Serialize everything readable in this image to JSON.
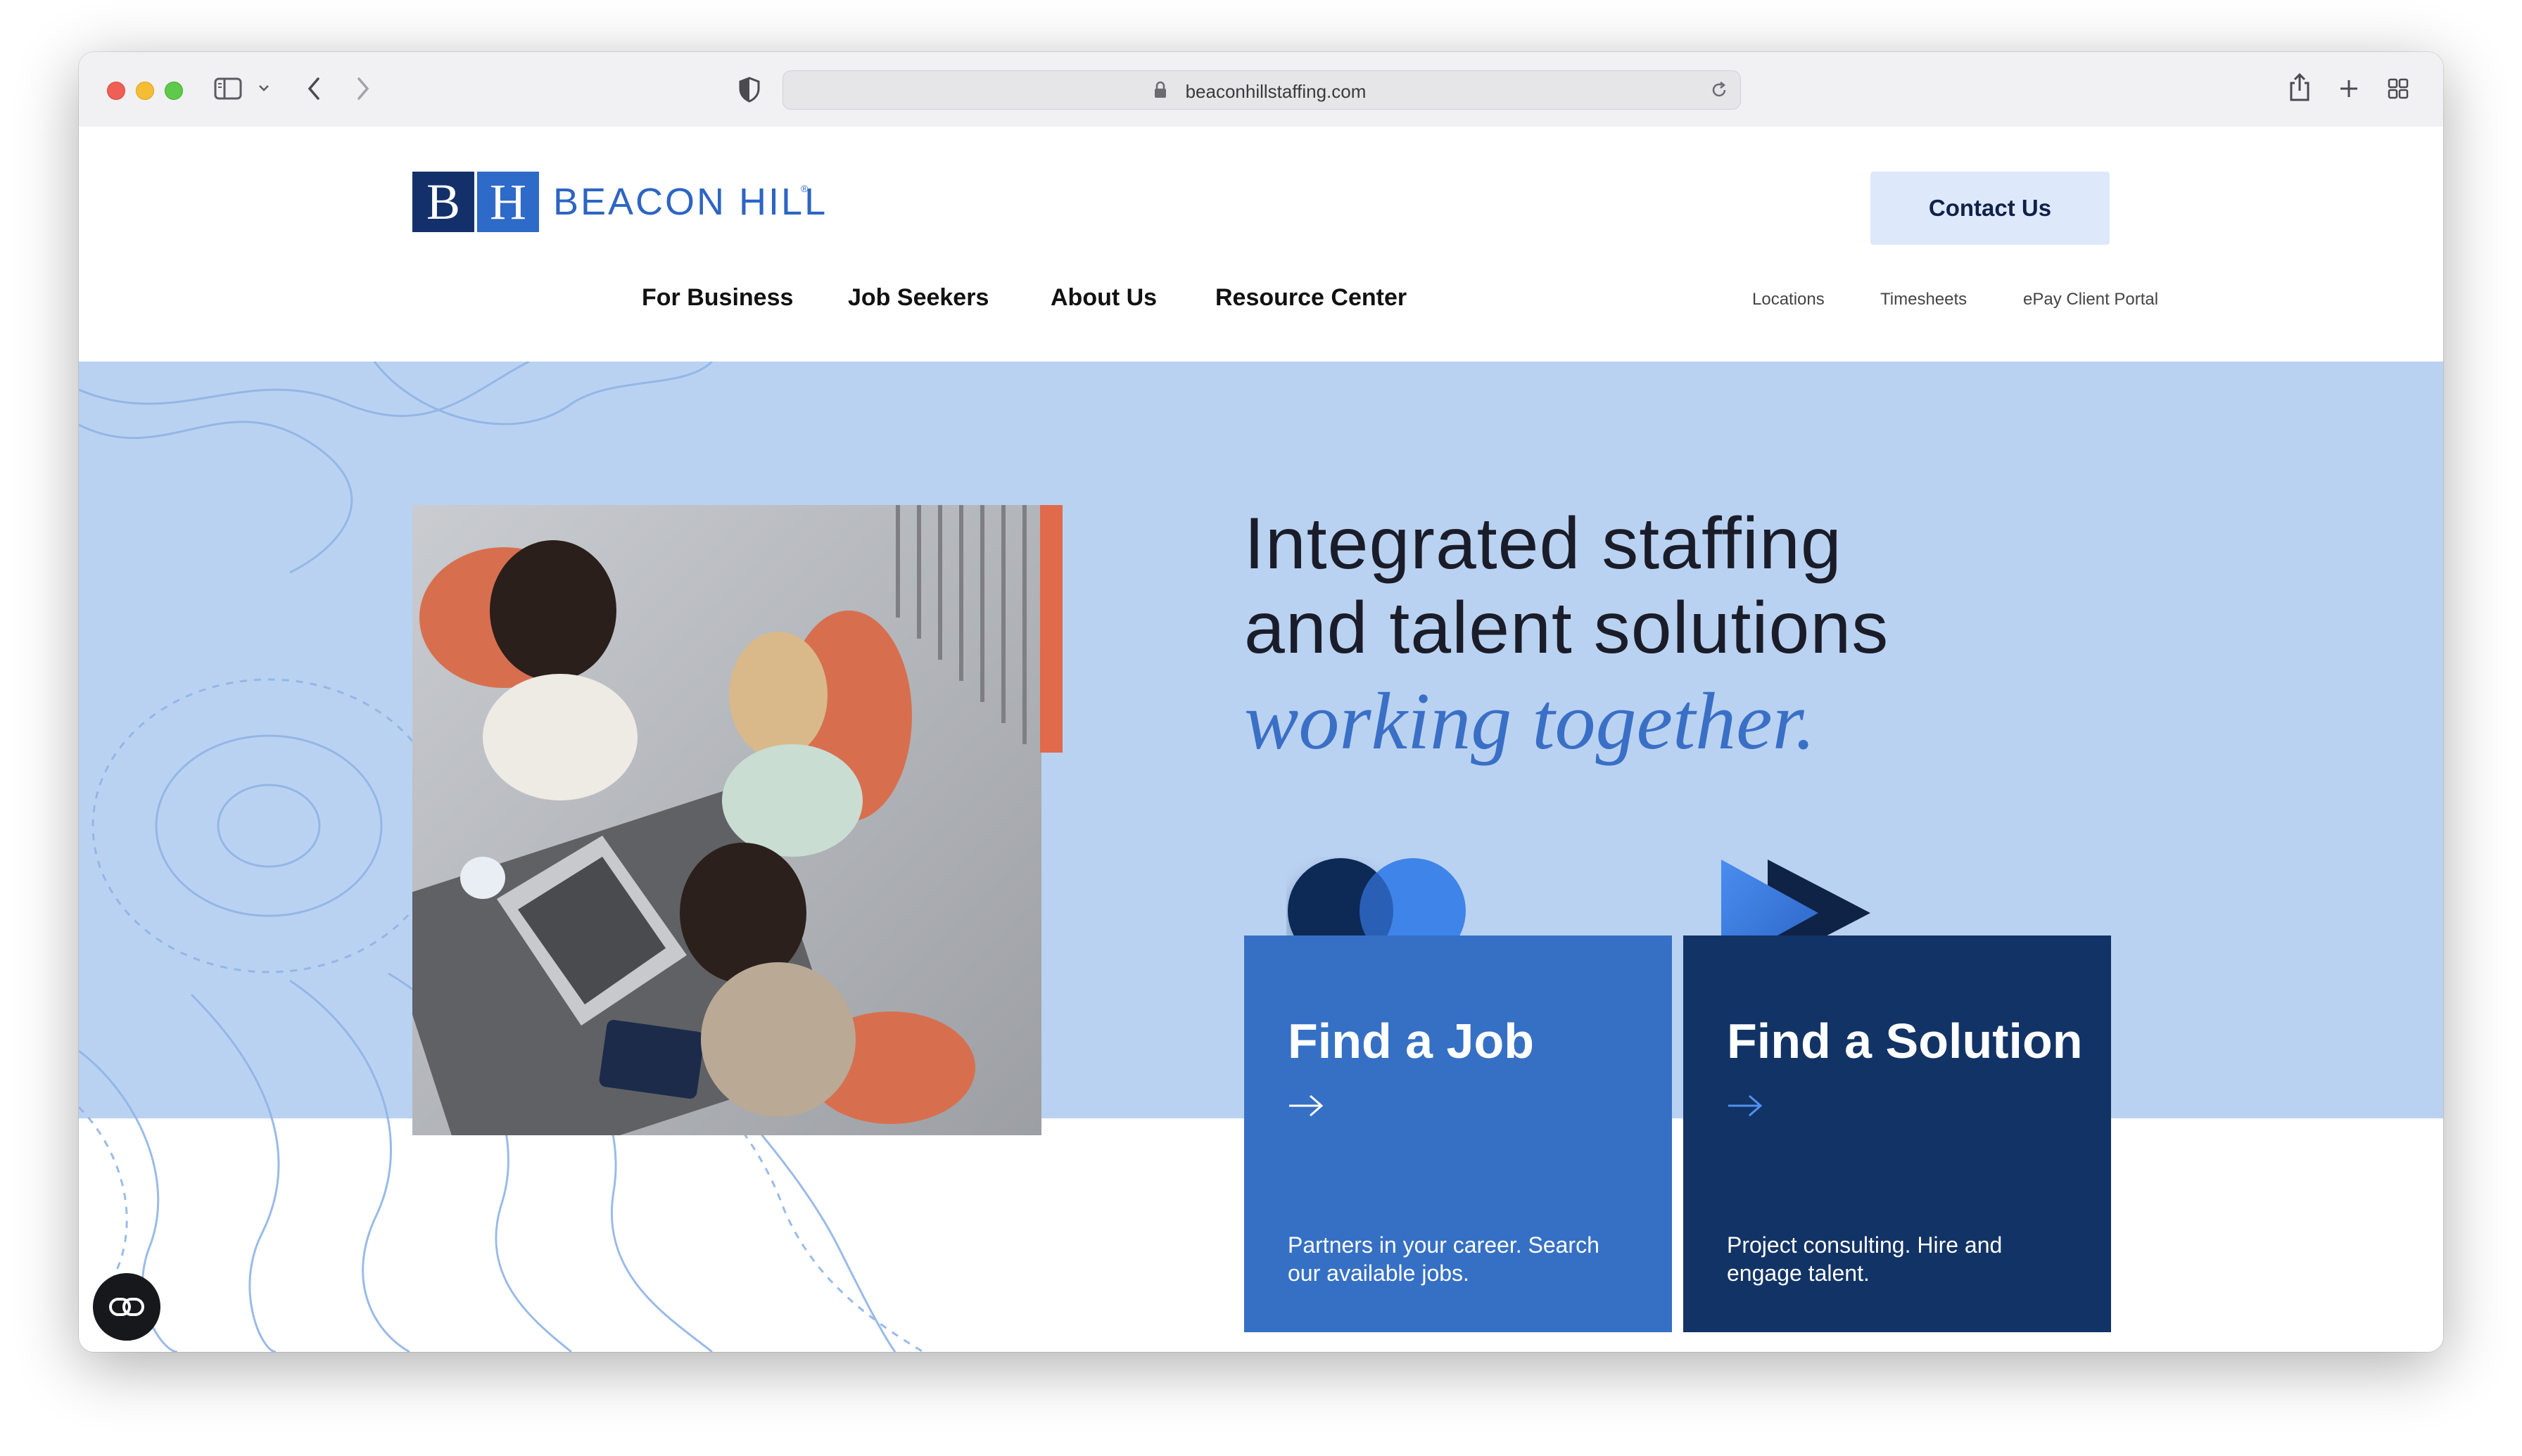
{
  "browser": {
    "url": "beaconhillstaffing.com"
  },
  "site": {
    "logo": {
      "mark_b": "B",
      "mark_h": "H",
      "name": "BEACON HILL",
      "reg": "®"
    },
    "contact_label": "Contact Us",
    "nav": [
      "For Business",
      "Job Seekers",
      "About Us",
      "Resource Center"
    ],
    "utility_links": [
      "Locations",
      "Timesheets",
      "ePay Client Portal"
    ]
  },
  "hero": {
    "line1": "Integrated staffing",
    "line2": "and talent solutions",
    "line3": "working together."
  },
  "cards": [
    {
      "title": "Find a Job",
      "description": "Partners in your career. Search our available jobs."
    },
    {
      "title": "Find a Solution",
      "description": "Project consulting. Hire and engage talent."
    }
  ],
  "colors": {
    "brand_navy": "#14306b",
    "brand_blue": "#2e6ac7",
    "hero_bg": "#bad2f1",
    "accent_orange": "#e06a4b",
    "card_blue": "#3570c5",
    "card_navy": "#123366"
  },
  "icons": [
    "sidebar-icon",
    "chevron-down-icon",
    "back-icon",
    "forward-icon",
    "shield-icon",
    "lock-icon",
    "reload-icon",
    "share-icon",
    "plus-icon",
    "grid-icon",
    "arrow-right-icon",
    "accessibility-icon"
  ]
}
